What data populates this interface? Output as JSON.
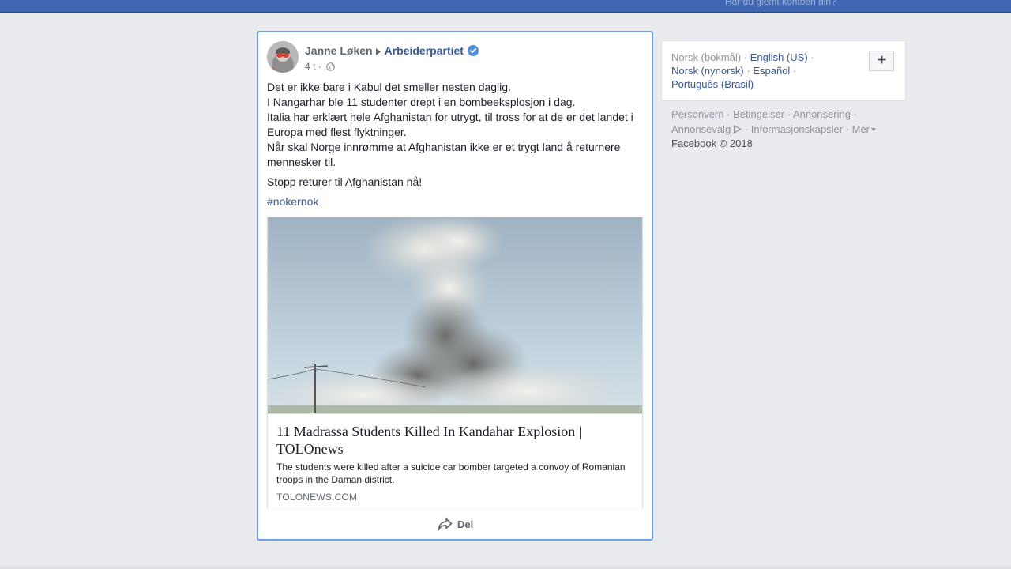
{
  "topbar": {
    "forgot_link": "Har du glemt kontoen din?"
  },
  "post": {
    "author": "Janne Løken",
    "page": "Arbeiderpartiet",
    "time": "4 t",
    "meta_separator": "·",
    "paragraphs": [
      "Det er ikke bare i Kabul det smeller nesten daglig.",
      "I Nangarhar ble 11 studenter drept i en bombeeksplosjon i dag.",
      "Italia har erklært hele Afghanistan for utrygt, til tross for at de er det landet i Europa med flest flyktninger.",
      "Når skal Norge innrømme at Afghanistan ikke er et trygt land å returnere mennesker til."
    ],
    "closing": "Stopp returer til Afghanistan nå!",
    "hashtag": "#nokernok",
    "attachment": {
      "title": "11 Madrassa Students Killed In Kandahar Explosion | TOLOnews",
      "description": "The students were killed after a suicide car bomber targeted a convoy of Romanian troops in the Daman district.",
      "domain": "TOLONEWS.COM"
    },
    "share_label": "Del"
  },
  "sidebar": {
    "languages": {
      "current": "Norsk (bokmål)",
      "others": [
        "English (US)",
        "Norsk (nynorsk)",
        "Español",
        "Português (Brasil)"
      ],
      "separator": " · "
    },
    "footer": {
      "links": [
        "Personvern",
        "Betingelser",
        "Annonsering",
        "Annonsevalg",
        "Informasjonskapsler",
        "Mer"
      ],
      "separator": " · ",
      "copyright": "Facebook © 2018"
    }
  },
  "colors": {
    "topbar": "#4267b2",
    "link": "#385898",
    "post_border": "#6d9eeb",
    "verified": "#4a90e2",
    "background": "#e9ebee"
  },
  "icons": {
    "arrow": "triangle-right-icon",
    "verified": "verified-badge-icon",
    "audience": "globe-icon",
    "share": "share-arrow-icon",
    "add_language": "plus-icon",
    "adchoices": "adchoices-icon",
    "more": "caret-down-icon"
  }
}
